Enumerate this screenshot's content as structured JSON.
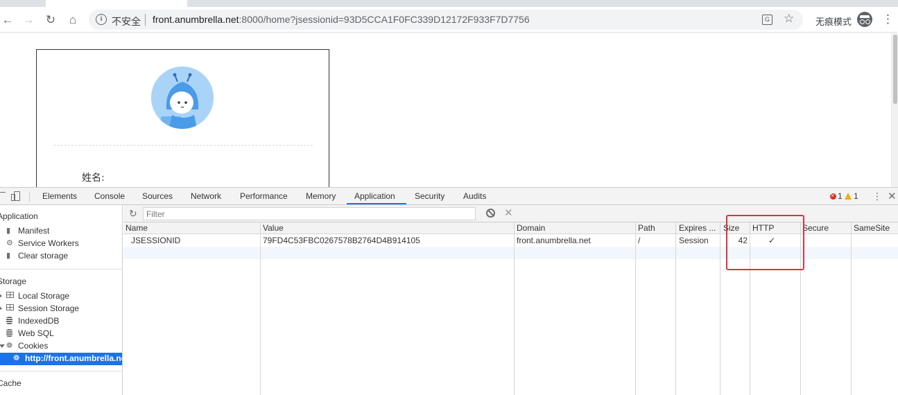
{
  "browser": {
    "security_label": "不安全",
    "url_host": "front.anumbrella.net",
    "url_rest": ":8000/home?jsessionid=93D5CCA1F0FC339D12172F933F7D7756",
    "incognito_label": "无痕模式"
  },
  "page": {
    "name_label": "姓名:"
  },
  "devtools": {
    "tabs": [
      "Elements",
      "Console",
      "Sources",
      "Network",
      "Performance",
      "Memory",
      "Application",
      "Security",
      "Audits"
    ],
    "active_tab": "Application",
    "error_count": "1",
    "warning_count": "1",
    "sidebar": {
      "application_heading": "Application",
      "application_items": [
        "Manifest",
        "Service Workers",
        "Clear storage"
      ],
      "storage_heading": "Storage",
      "storage_items": [
        "Local Storage",
        "Session Storage",
        "IndexedDB",
        "Web SQL",
        "Cookies"
      ],
      "cookie_origin": "http://front.anumbrella.net",
      "cache_heading": "Cache"
    },
    "cookies": {
      "filter_placeholder": "Filter",
      "columns": [
        "Name",
        "Value",
        "Domain",
        "Path",
        "Expires ...",
        "Size",
        "HTTP",
        "Secure",
        "SameSite"
      ],
      "rows": [
        {
          "name": "JSESSIONID",
          "value": "79FD4C53FBC0267578B2764D4B914105",
          "domain": "front.anumbrella.net",
          "path": "/",
          "expires": "Session",
          "size": "42",
          "http": "✓",
          "secure": "",
          "samesite": ""
        }
      ]
    }
  },
  "colors": {
    "accent": "#1a73e8",
    "highlight_box": "#e0313d",
    "error": "#d93025",
    "warning": "#f9ab00"
  }
}
